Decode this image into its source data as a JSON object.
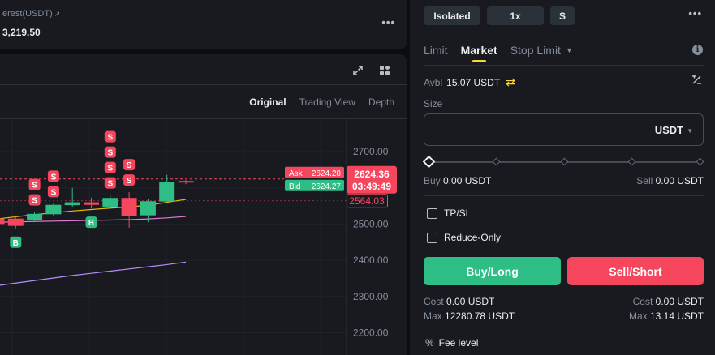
{
  "ticker": {
    "label": "erest(USDT)",
    "arrow_icon": "external-arrow-icon",
    "value": "3,219.50"
  },
  "chart_toolbar": {
    "icons": [
      "expand-icon",
      "layout-grid-icon"
    ],
    "view_tabs": [
      {
        "label": "Original",
        "active": true
      },
      {
        "label": "Trading View",
        "active": false
      },
      {
        "label": "Depth",
        "active": false
      }
    ]
  },
  "chart_data": {
    "type": "candlestick",
    "y_ticks": [
      "2700.00",
      "2600.00",
      "2500.00",
      "2400.00",
      "2300.00",
      "2200.00"
    ],
    "ylim": [
      2180,
      2760
    ],
    "candles": [
      {
        "open": 2515,
        "close": 2500,
        "high": 2520,
        "low": 2495,
        "dir": "down"
      },
      {
        "open": 2515,
        "close": 2495,
        "high": 2520,
        "low": 2488,
        "dir": "down"
      },
      {
        "open": 2510,
        "close": 2528,
        "high": 2533,
        "low": 2505,
        "dir": "up"
      },
      {
        "open": 2527,
        "close": 2553,
        "high": 2556,
        "low": 2523,
        "dir": "up"
      },
      {
        "open": 2552,
        "close": 2560,
        "high": 2600,
        "low": 2548,
        "dir": "up"
      },
      {
        "open": 2560,
        "close": 2553,
        "high": 2573,
        "low": 2543,
        "dir": "down"
      },
      {
        "open": 2548,
        "close": 2572,
        "high": 2580,
        "low": 2543,
        "dir": "up"
      },
      {
        "open": 2572,
        "close": 2522,
        "high": 2588,
        "low": 2490,
        "dir": "down"
      },
      {
        "open": 2524,
        "close": 2563,
        "high": 2570,
        "low": 2505,
        "dir": "up"
      },
      {
        "open": 2562,
        "close": 2616,
        "high": 2636,
        "low": 2560,
        "dir": "up"
      },
      {
        "open": 2619,
        "close": 2616,
        "high": 2622,
        "low": 2610,
        "dir": "down"
      }
    ],
    "sell_markers": [
      {
        "candle": 2,
        "stack": 2
      },
      {
        "candle": 3,
        "stack": 2
      },
      {
        "candle": 6,
        "stack": 4
      },
      {
        "candle": 7,
        "stack": 2
      }
    ],
    "buy_markers": [
      1,
      5
    ],
    "marker_labels": {
      "sell": "S",
      "buy": "B"
    },
    "ask": {
      "label": "Ask",
      "price": "2624.28",
      "last_price": "2624.36",
      "countdown": "03:49:49",
      "level": 2624.36
    },
    "bid": {
      "label": "Bid",
      "price": "2624.27"
    },
    "mark_price": {
      "price": "2564.03",
      "level": 2564.03
    },
    "ma_yellow": [
      2514,
      2520,
      2526,
      2531,
      2536,
      2540,
      2544,
      2547,
      2552,
      2560,
      2568
    ],
    "ma_pink": [
      2505,
      2506,
      2507,
      2508,
      2509,
      2510,
      2511,
      2512,
      2514,
      2517,
      2521
    ],
    "ma_purple": [
      2330,
      2337,
      2344,
      2351,
      2358,
      2364,
      2370,
      2376,
      2382,
      2388,
      2395
    ],
    "colors": {
      "up": "#2ebd85",
      "down": "#f6465d",
      "yellow": "#f0b90b",
      "pink": "#e07ad6",
      "purple": "#b98cff"
    }
  },
  "order_panel": {
    "margin_mode": "Isolated",
    "leverage": "1x",
    "asset_mode": "S",
    "tabs": [
      {
        "label": "Limit",
        "active": false
      },
      {
        "label": "Market",
        "active": true
      },
      {
        "label": "Stop Limit",
        "active": false
      }
    ],
    "avbl_label": "Avbl",
    "avbl_value": "15.07 USDT",
    "size_label": "Size",
    "size_value": "",
    "size_unit": "USDT",
    "slider_percent": 0,
    "buy_label": "Buy",
    "buy_value": "0.00 USDT",
    "sell_label": "Sell",
    "sell_value": "0.00 USDT",
    "tpsl_label": "TP/SL",
    "tpsl_checked": false,
    "reduce_only_label": "Reduce-Only",
    "reduce_only_checked": false,
    "buy_button": "Buy/Long",
    "sell_button": "Sell/Short",
    "cost_label": "Cost",
    "buy_cost": "0.00 USDT",
    "sell_cost": "0.00 USDT",
    "max_label": "Max",
    "buy_max": "12280.78 USDT",
    "sell_max": "13.14 USDT",
    "fee_label": "Fee level",
    "colors": {
      "buy": "#2ebd85",
      "sell": "#f6465d",
      "accent": "#fcd535"
    }
  }
}
